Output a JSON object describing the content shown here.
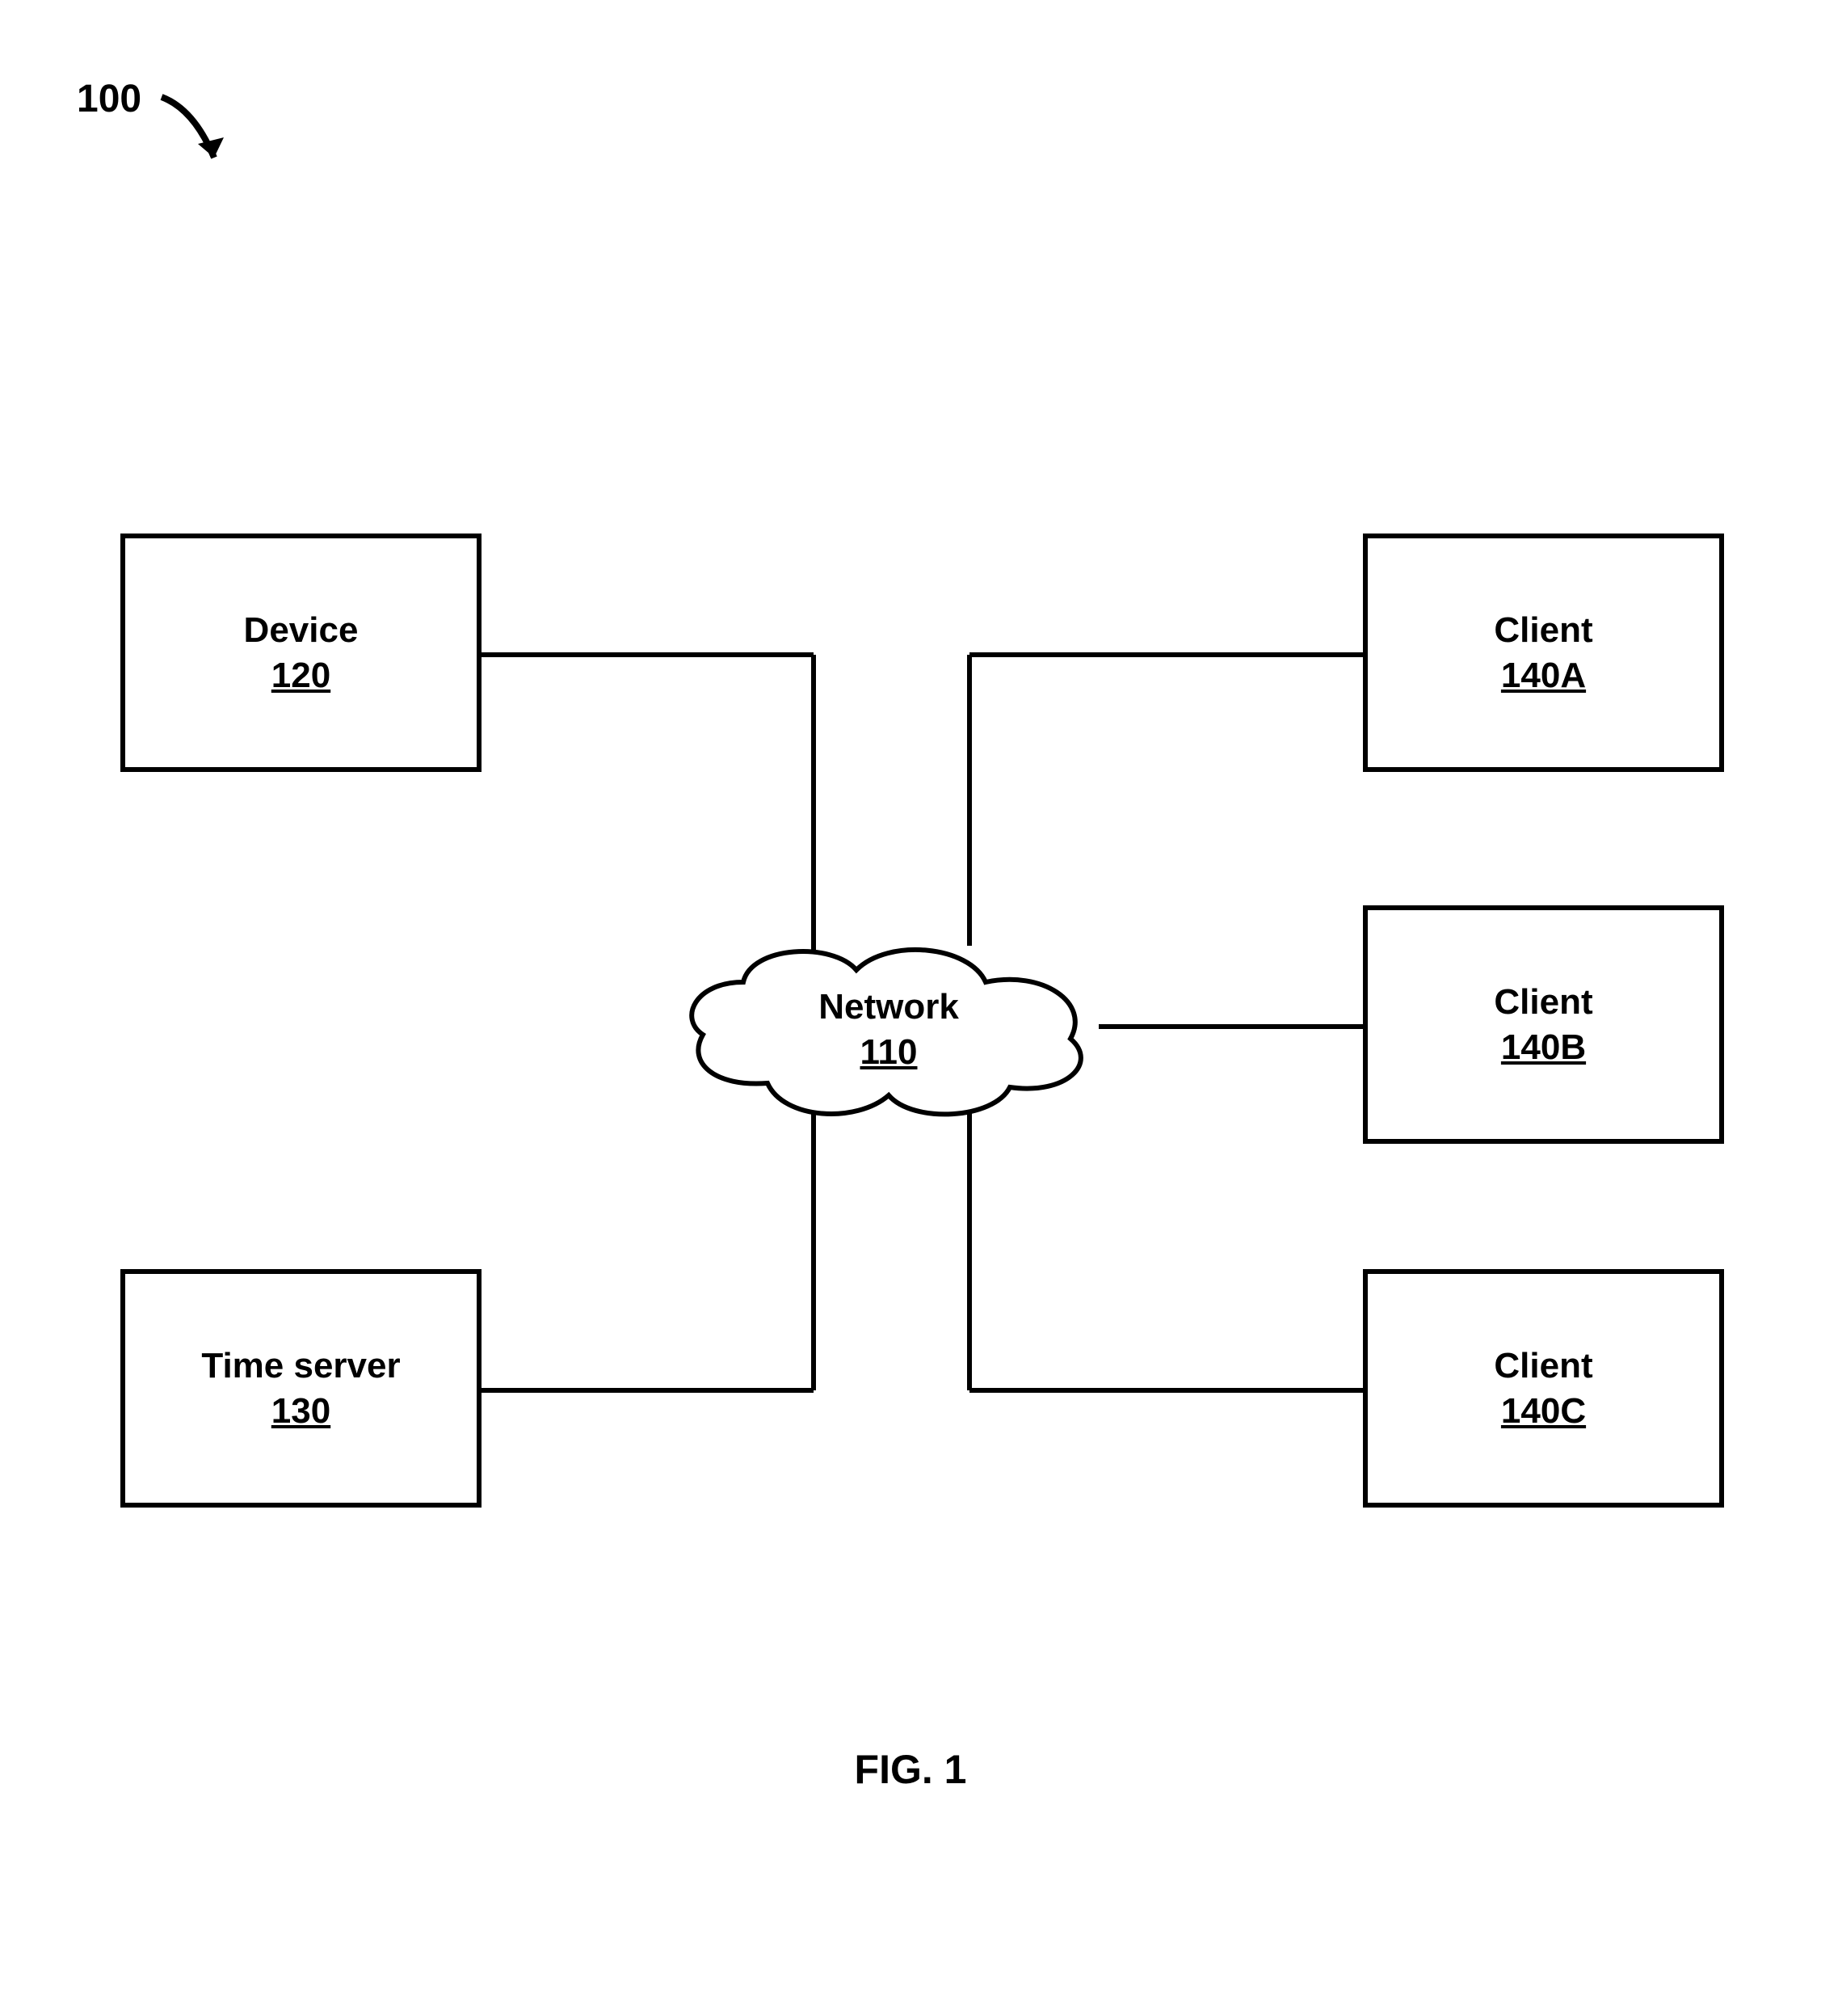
{
  "figure": {
    "ref_number": "100",
    "caption": "FIG. 1"
  },
  "nodes": {
    "device": {
      "title": "Device",
      "ref": "120"
    },
    "time_server": {
      "title": "Time server",
      "ref": "130"
    },
    "network": {
      "title": "Network",
      "ref": "110"
    },
    "client_a": {
      "title": "Client",
      "ref": "140A"
    },
    "client_b": {
      "title": "Client",
      "ref": "140B"
    },
    "client_c": {
      "title": "Client",
      "ref": "140C"
    }
  }
}
